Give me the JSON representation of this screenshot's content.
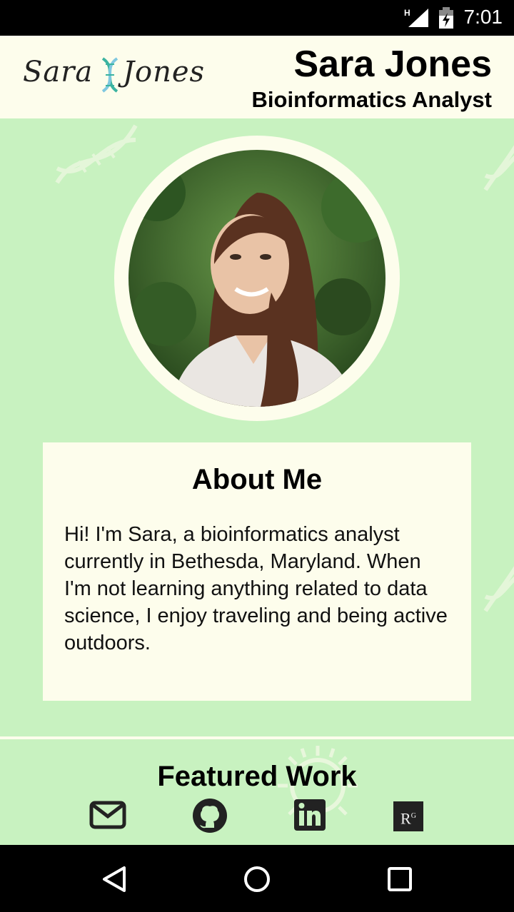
{
  "status_bar": {
    "time": "7:01",
    "network": "H"
  },
  "header": {
    "logo_left": "Sara",
    "logo_right": "Jones",
    "name": "Sara Jones",
    "role": "Bioinformatics Analyst"
  },
  "about": {
    "heading": "About Me",
    "body": "Hi! I'm Sara, a bioinformatics analyst currently in Bethesda, Maryland. When I'm not learning anything related to data science, I enjoy traveling and being active outdoors."
  },
  "featured": {
    "heading": "Featured Work"
  },
  "social": [
    {
      "icon": "email-icon"
    },
    {
      "icon": "github-icon"
    },
    {
      "icon": "linkedin-icon"
    },
    {
      "icon": "researchgate-icon",
      "text": "R",
      "sup": "G"
    }
  ],
  "colors": {
    "background": "#c8f2c0",
    "card": "#fdfdec",
    "text": "#000000"
  }
}
